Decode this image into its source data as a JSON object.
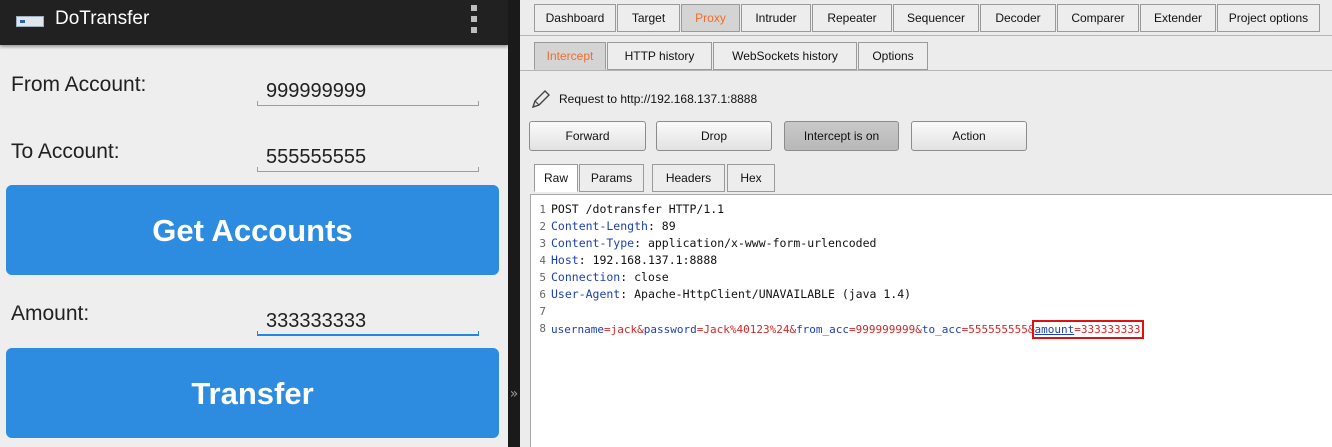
{
  "android": {
    "title": "DoTransfer",
    "from_label": "From Account:",
    "from_value": "999999999",
    "to_label": "To Account:",
    "to_value": "555555555",
    "get_accounts_label": "Get Accounts",
    "amount_label": "Amount:",
    "amount_value": "333333333",
    "transfer_label": "Transfer"
  },
  "burp": {
    "tabs": [
      "Dashboard",
      "Target",
      "Proxy",
      "Intruder",
      "Repeater",
      "Sequencer",
      "Decoder",
      "Comparer",
      "Extender",
      "Project options"
    ],
    "selected_tab": "Proxy",
    "proxy_tabs": [
      "Intercept",
      "HTTP history",
      "WebSockets history",
      "Options"
    ],
    "request_to": "Request to http://192.168.137.1:8888",
    "buttons": {
      "forward": "Forward",
      "drop": "Drop",
      "intercept": "Intercept is on",
      "action": "Action"
    },
    "editor_tabs": [
      "Raw",
      "Params",
      "Headers",
      "Hex"
    ],
    "lines": {
      "l1": "POST /dotransfer HTTP/1.1",
      "l2_key": "Content-Length",
      "l2_val": " 89",
      "l3_key": "Content-Type",
      "l3_val": " application/x-www-form-urlencoded",
      "l4_key": "Host",
      "l4_val": " 192.168.137.1:8888",
      "l5_key": "Connection",
      "l5_val": " close",
      "l6_key": "User-Agent",
      "l6_val": " Apache-HttpClient/UNAVAILABLE (java 1.4)",
      "params": {
        "p1k": "username",
        "p1v": "jack",
        "p2k": "password",
        "p2v": "Jack%40123%24",
        "p3k": "from_acc",
        "p3v": "999999999",
        "p4k": "to_acc",
        "p4v": "555555555",
        "p5k": "amount",
        "p5v": "333333333"
      }
    },
    "line_numbers": [
      "1",
      "2",
      "3",
      "4",
      "5",
      "6",
      "7",
      "8"
    ]
  },
  "colors": {
    "android_button": "#2d8be0",
    "burp_selected_tab": "#f26d2a",
    "highlight_box": "#e01010"
  }
}
